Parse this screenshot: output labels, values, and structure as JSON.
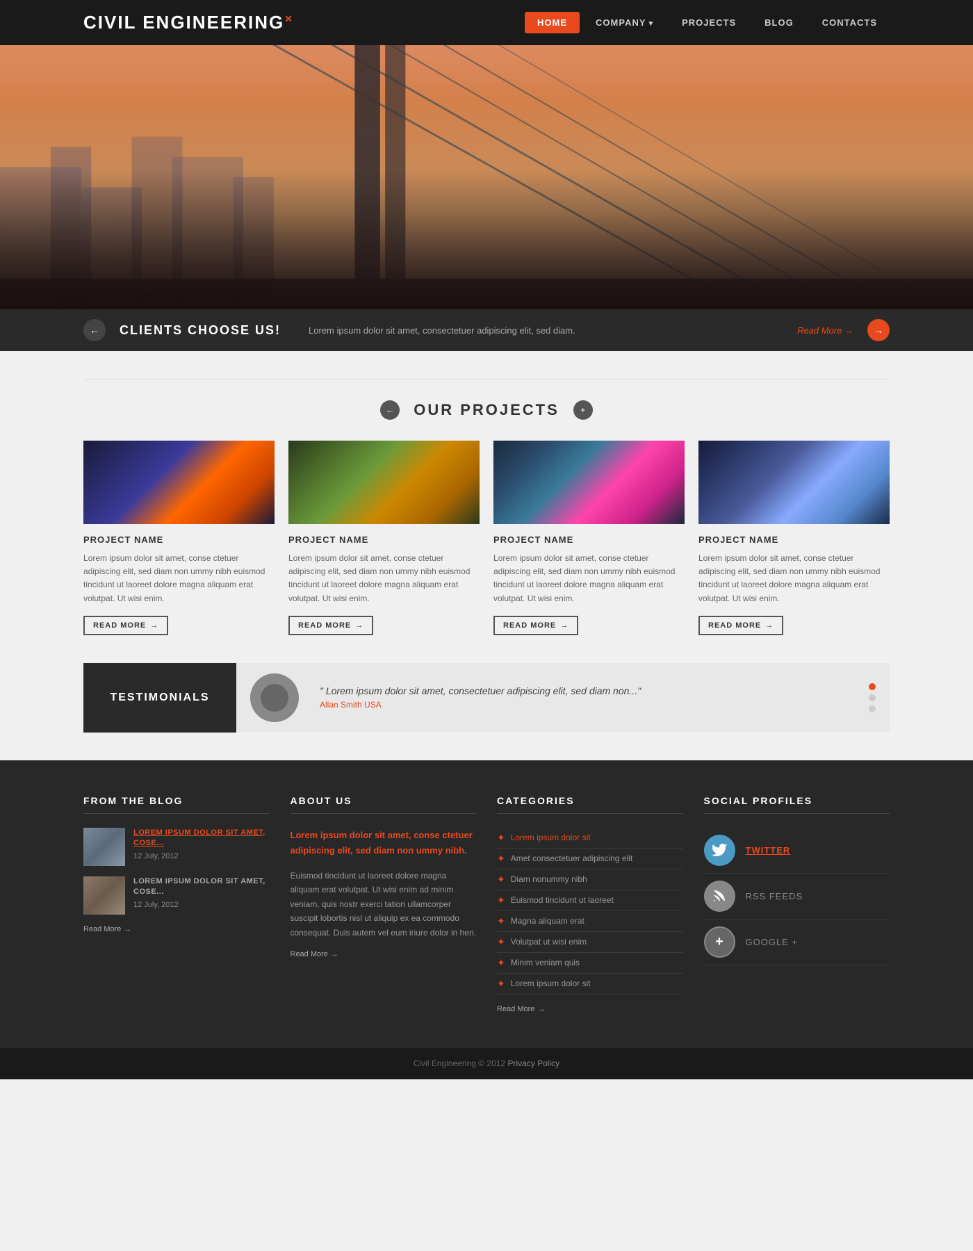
{
  "header": {
    "logo": "CIVIL ENGINEERING",
    "logo_x": "✕",
    "nav": {
      "home": "HOME",
      "company": "COMPANY",
      "projects": "PROJECTS",
      "blog": "BLOG",
      "contacts": "CONTACTS"
    }
  },
  "slider": {
    "title": "CLIENTS CHOOSE US!",
    "text": "Lorem ipsum dolor sit amet, consectetuer adipiscing elit, sed diam.",
    "link": "Read More →",
    "prev": "←",
    "next": "→"
  },
  "projects": {
    "section_title": "OUR PROJECTS",
    "prev": "←",
    "next": "+",
    "items": [
      {
        "name": "PROJECT NAME",
        "desc": "Lorem ipsum dolor sit amet, conse ctetuer adipiscing elit, sed diam non ummy nibh euismod tincidunt ut laoreet dolore magna aliquam erat volutpat. Ut wisi enim.",
        "btn": "Read More"
      },
      {
        "name": "PROJECT NAME",
        "desc": "Lorem ipsum dolor sit amet, conse ctetuer adipiscing elit, sed diam non ummy nibh euismod tincidunt ut laoreet dolore magna aliquam erat volutpat. Ut wisi enim.",
        "btn": "Read More"
      },
      {
        "name": "PROJECT NAME",
        "desc": "Lorem ipsum dolor sit amet, conse ctetuer adipiscing elit, sed diam non ummy nibh euismod tincidunt ut laoreet dolore magna aliquam erat volutpat. Ut wisi enim.",
        "btn": "Read More"
      },
      {
        "name": "PROJECT NAME",
        "desc": "Lorem ipsum dolor sit amet, conse ctetuer adipiscing elit, sed diam non ummy nibh euismod tincidunt ut laoreet dolore magna aliquam erat volutpat. Ut wisi enim.",
        "btn": "Read More"
      }
    ]
  },
  "testimonials": {
    "label": "TESTIMONIALS",
    "quote": "\" Lorem ipsum dolor sit amet, consectetuer adipiscing elit, sed diam non...\"",
    "author": "Allan Smith",
    "location": "USA"
  },
  "blog": {
    "title": "FROM THE BLOG",
    "items": [
      {
        "title": "LOREM IPSUM DOLOR SIT AMET, COSE...",
        "date": "12 July, 2012"
      },
      {
        "title": "LOREM IPSUM DOLOR SIT AMET, COSE...",
        "date": "12 July, 2012"
      }
    ],
    "read_more": "Read More"
  },
  "about": {
    "title": "ABOUT US",
    "highlight": "Lorem ipsum dolor sit amet, conse ctetuer adipiscing elit, sed diam non ummy nibh.",
    "body": "Euismod tincidunt ut laoreet dolore magna aliquam erat volutpat. Ut wisi enim ad minim veniam, quis nostr exerci tation ullamcorper suscipit lobortis nisl ut aliquip ex ea commodo consequat. Duis autem vel eum iriure dolor in hen.",
    "read_more": "Read More"
  },
  "categories": {
    "title": "CATEGORIES",
    "items": [
      {
        "label": "Lorem ipsum dolor sit",
        "highlight": true
      },
      {
        "label": "Amet consectetuer adipiscing elit",
        "highlight": false
      },
      {
        "label": "Diam nonummy nibh",
        "highlight": false
      },
      {
        "label": "Euismod tincidunt ut laoreet",
        "highlight": false
      },
      {
        "label": "Magna aliquam erat",
        "highlight": false
      },
      {
        "label": "Volutpat ut wisi enim",
        "highlight": false
      },
      {
        "label": "Minim veniam quis",
        "highlight": false
      },
      {
        "label": "Lorem ipsum dolor sit",
        "highlight": false
      }
    ],
    "read_more": "Read More"
  },
  "social": {
    "title": "SOCIAL PROFILES",
    "items": [
      {
        "label": "TWITTER",
        "type": "twitter",
        "icon": "🐦"
      },
      {
        "label": "RSS FEEDS",
        "type": "rss",
        "icon": "◉"
      },
      {
        "label": "GOOGLE +",
        "type": "google",
        "icon": "+"
      }
    ]
  },
  "footer": {
    "text": "Civil Engineering © 2012",
    "link": "Privacy Policy"
  }
}
